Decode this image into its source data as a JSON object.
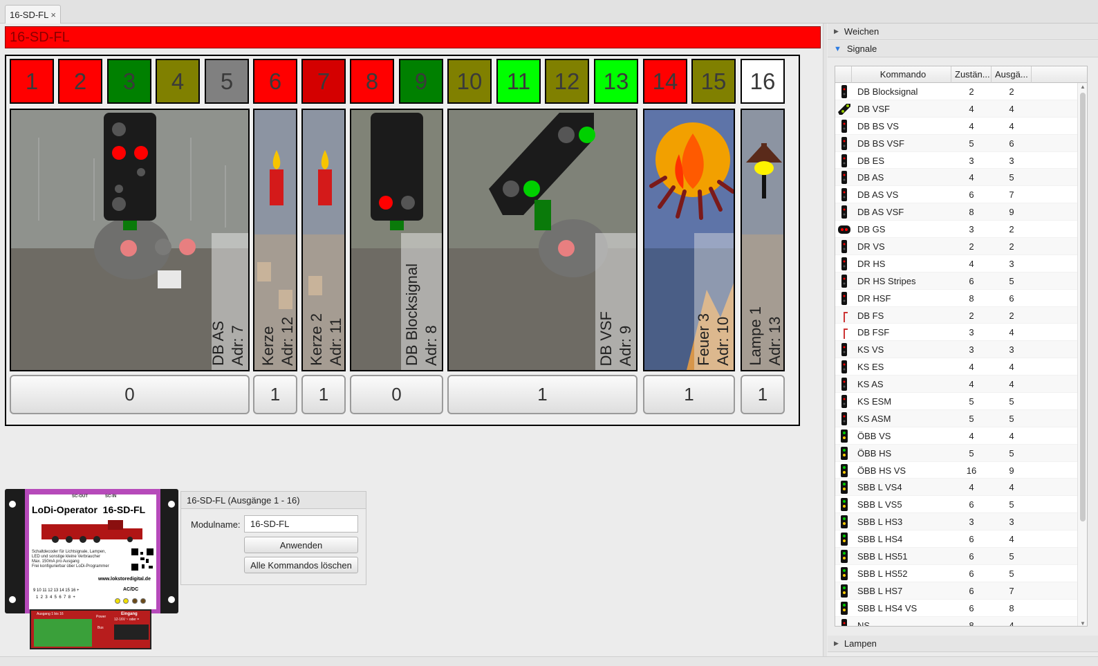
{
  "tab": {
    "label": "16-SD-FL",
    "close": "×"
  },
  "module_title": "16-SD-FL",
  "outputs": [
    {
      "n": "1",
      "color": "#ff0000"
    },
    {
      "n": "2",
      "color": "#ff0000"
    },
    {
      "n": "3",
      "color": "#008000"
    },
    {
      "n": "4",
      "color": "#808000"
    },
    {
      "n": "5",
      "color": "#808080"
    },
    {
      "n": "6",
      "color": "#ff0000"
    },
    {
      "n": "7",
      "color": "#d40000"
    },
    {
      "n": "8",
      "color": "#ff0000"
    },
    {
      "n": "9",
      "color": "#008000"
    },
    {
      "n": "10",
      "color": "#808000"
    },
    {
      "n": "11",
      "color": "#00ff00"
    },
    {
      "n": "12",
      "color": "#808000"
    },
    {
      "n": "13",
      "color": "#00ff00"
    },
    {
      "n": "14",
      "color": "#ff0000"
    },
    {
      "n": "15",
      "color": "#808000"
    },
    {
      "n": "16",
      "color": "#ffffff"
    }
  ],
  "devices": [
    {
      "name": "DB AS",
      "addr": "Adr: 7",
      "value": "0",
      "icon": "db-as-signal-icon"
    },
    {
      "name": "Kerze",
      "addr": "Adr: 12",
      "value": "1",
      "icon": "candle-icon"
    },
    {
      "name": "Kerze 2",
      "addr": "Adr: 11",
      "value": "1",
      "icon": "candle-icon"
    },
    {
      "name": "DB Blocksignal",
      "addr": "Adr: 8",
      "value": "0",
      "icon": "block-signal-icon"
    },
    {
      "name": "DB VSF",
      "addr": "Adr: 9",
      "value": "1",
      "icon": "db-vsf-signal-icon"
    },
    {
      "name": "Feuer 3",
      "addr": "Adr: 10",
      "value": "1",
      "icon": "fire-icon"
    },
    {
      "name": "Lampe 1",
      "addr": "Adr: 13",
      "value": "1",
      "icon": "lamp-icon"
    }
  ],
  "module_panel": {
    "header": "16-SD-FL (Ausgänge 1 - 16)",
    "name_label": "Modulname:",
    "name_value": "16-SD-FL",
    "apply_label": "Anwenden",
    "clear_label": "Alle Kommandos löschen"
  },
  "device_image": {
    "brand": "LoDi-Operator  16-SD-FL",
    "sc_out": "SC-OUT",
    "sc_in": "SC-IN",
    "bullets": [
      "Schaltdecoder für Lichtsignale, Lampen,",
      "LED und sonstige kleine Verbraucher",
      "Max. 150mA pro Ausgang",
      "Frei konfigurierbar über LoDi-Programmer"
    ],
    "url": "www.lokstoredigital.de",
    "acdc": "AC/DC",
    "pins_top": "9 10 11 12 13 14 15 16 +",
    "pins_bottom": "1  2  3  4  5  6  7  8  +",
    "term_out": "Ausgang 1 bis 16",
    "term_power": "Power",
    "term_bus": "Bus",
    "term_in": "Eingang",
    "term_volt": "12-16V ~ oder ="
  },
  "sidebar": {
    "weichen": "Weichen",
    "signale": "Signale",
    "lampen": "Lampen",
    "columns": [
      "Kommando",
      "Zustän...",
      "Ausgä..."
    ],
    "rows": [
      {
        "name": "DB Blocksignal",
        "z": "2",
        "a": "2"
      },
      {
        "name": "DB VSF",
        "z": "4",
        "a": "4"
      },
      {
        "name": "DB BS VS",
        "z": "4",
        "a": "4"
      },
      {
        "name": "DB BS VSF",
        "z": "5",
        "a": "6"
      },
      {
        "name": "DB ES",
        "z": "3",
        "a": "3"
      },
      {
        "name": "DB AS",
        "z": "4",
        "a": "5"
      },
      {
        "name": "DB AS VS",
        "z": "6",
        "a": "7"
      },
      {
        "name": "DB AS VSF",
        "z": "8",
        "a": "9"
      },
      {
        "name": "DB GS",
        "z": "3",
        "a": "2"
      },
      {
        "name": "DR VS",
        "z": "2",
        "a": "2"
      },
      {
        "name": "DR HS",
        "z": "4",
        "a": "3"
      },
      {
        "name": "DR HS Stripes",
        "z": "6",
        "a": "5"
      },
      {
        "name": "DR HSF",
        "z": "8",
        "a": "6"
      },
      {
        "name": "DB FS",
        "z": "2",
        "a": "2"
      },
      {
        "name": "DB FSF",
        "z": "3",
        "a": "4"
      },
      {
        "name": "KS VS",
        "z": "3",
        "a": "3"
      },
      {
        "name": "KS ES",
        "z": "4",
        "a": "4"
      },
      {
        "name": "KS AS",
        "z": "4",
        "a": "4"
      },
      {
        "name": "KS ESM",
        "z": "5",
        "a": "5"
      },
      {
        "name": "KS ASM",
        "z": "5",
        "a": "5"
      },
      {
        "name": "ÖBB VS",
        "z": "4",
        "a": "4"
      },
      {
        "name": "ÖBB HS",
        "z": "5",
        "a": "5"
      },
      {
        "name": "ÖBB HS VS",
        "z": "16",
        "a": "9"
      },
      {
        "name": "SBB L VS4",
        "z": "4",
        "a": "4"
      },
      {
        "name": "SBB L VS5",
        "z": "6",
        "a": "5"
      },
      {
        "name": "SBB L HS3",
        "z": "3",
        "a": "3"
      },
      {
        "name": "SBB L HS4",
        "z": "6",
        "a": "4"
      },
      {
        "name": "SBB L HS51",
        "z": "6",
        "a": "5"
      },
      {
        "name": "SBB L HS52",
        "z": "6",
        "a": "5"
      },
      {
        "name": "SBB L HS7",
        "z": "6",
        "a": "7"
      },
      {
        "name": "SBB L HS4 VS",
        "z": "6",
        "a": "8"
      },
      {
        "name": "NS",
        "z": "8",
        "a": "4"
      }
    ]
  }
}
